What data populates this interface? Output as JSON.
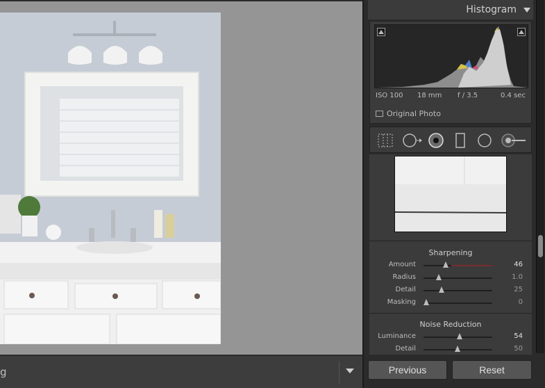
{
  "canvas": {
    "toolbar_label": "g"
  },
  "histogram": {
    "title": "Histogram",
    "iso": "ISO 100",
    "focal": "18 mm",
    "aperture": "f / 3.5",
    "shutter": "0.4 sec",
    "original_photo_label": "Original Photo"
  },
  "tools": [
    "crop-overlay-icon",
    "spot-removal-icon",
    "red-eye-icon",
    "graduated-filter-icon",
    "radial-filter-icon",
    "adjustment-brush-icon"
  ],
  "sharpening": {
    "title": "Sharpening",
    "sliders": [
      {
        "label": "Amount",
        "value": "46",
        "level": 0.31
      },
      {
        "label": "Radius",
        "value": "1.0",
        "level": 0.2
      },
      {
        "label": "Detail",
        "value": "25",
        "level": 0.25
      },
      {
        "label": "Masking",
        "value": "0",
        "level": 0.0
      }
    ]
  },
  "noise_reduction": {
    "title": "Noise Reduction",
    "sliders": [
      {
        "label": "Luminance",
        "value": "54",
        "level": 0.54
      },
      {
        "label": "Detail",
        "value": "50",
        "level": 0.5
      }
    ]
  },
  "buttons": {
    "previous": "Previous",
    "reset": "Reset"
  }
}
